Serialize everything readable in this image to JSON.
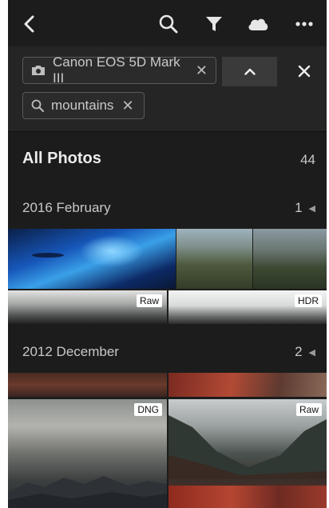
{
  "topbar": {
    "back_icon": "chevron-left-icon",
    "search_icon": "search-icon",
    "filter_icon": "funnel-icon",
    "cloud_icon": "cloud-icon",
    "more_icon": "more-horizontal-icon"
  },
  "filters": {
    "camera_chip": {
      "icon": "camera-icon",
      "label": "Canon EOS 5D Mark III"
    },
    "search_chip": {
      "icon": "search-icon",
      "label": "mountains"
    },
    "collapse_icon": "chevron-up-icon",
    "clear_icon": "close-icon"
  },
  "all_photos": {
    "title": "All Photos",
    "count": "44"
  },
  "groups": [
    {
      "date": "2016 February",
      "count": "1",
      "badges": [
        "Raw",
        "HDR"
      ]
    },
    {
      "date": "2012 December",
      "count": "2",
      "badges": [
        "DNG",
        "Raw"
      ]
    }
  ],
  "colors": {
    "background": "#1c1c1c",
    "filter_bar": "#252525",
    "text": "#ececec",
    "muted_text": "#c8c8c8"
  }
}
